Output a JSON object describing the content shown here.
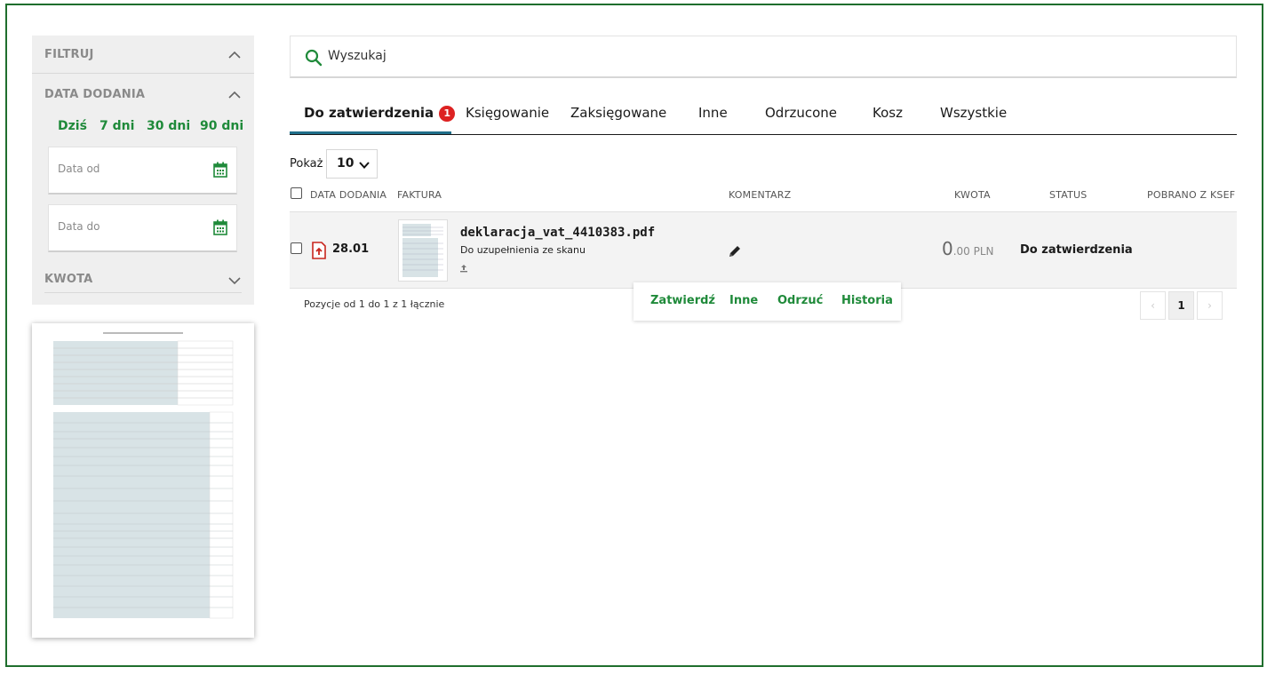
{
  "sidebar": {
    "filter_title": "FILTRUJ",
    "date_section_title": "DATA DODANIA",
    "quick_ranges": [
      "Dziś",
      "7 dni",
      "30 dni",
      "90 dni"
    ],
    "date_from_placeholder": "Data od",
    "date_to_placeholder": "Data do",
    "amount_section_title": "KWOTA"
  },
  "search": {
    "placeholder": "Wyszukaj"
  },
  "tabs": [
    {
      "label": "Do zatwierdzenia",
      "badge": "1",
      "active": true
    },
    {
      "label": "Księgowanie"
    },
    {
      "label": "Zaksięgowane"
    },
    {
      "label": "Inne"
    },
    {
      "label": "Odrzucone"
    },
    {
      "label": "Kosz"
    },
    {
      "label": "Wszystkie"
    }
  ],
  "show": {
    "label": "Pokaż",
    "value": "10"
  },
  "table": {
    "headers": {
      "date": "DATA DODANIA",
      "invoice": "FAKTURA",
      "comment": "KOMENTARZ",
      "amount": "KWOTA",
      "status": "STATUS",
      "ksef": "POBRANO Z KSEF"
    },
    "rows": [
      {
        "date": "28.01",
        "file_name": "deklaracja_vat_4410383.pdf",
        "note": "Do uzupełnienia ze skanu",
        "amount_int": "0",
        "amount_dec": ".00 PLN",
        "status": "Do zatwierdzenia"
      }
    ]
  },
  "row_actions": [
    "Zatwierdź",
    "Inne",
    "Odrzuć",
    "Historia"
  ],
  "positions_text": "Pozycje od 1 do 1 z 1 łącznie",
  "pagination": {
    "current": "1"
  },
  "colors": {
    "accent": "#1f8a3a",
    "frame": "#1f6e2d",
    "badge": "#dd2222"
  }
}
